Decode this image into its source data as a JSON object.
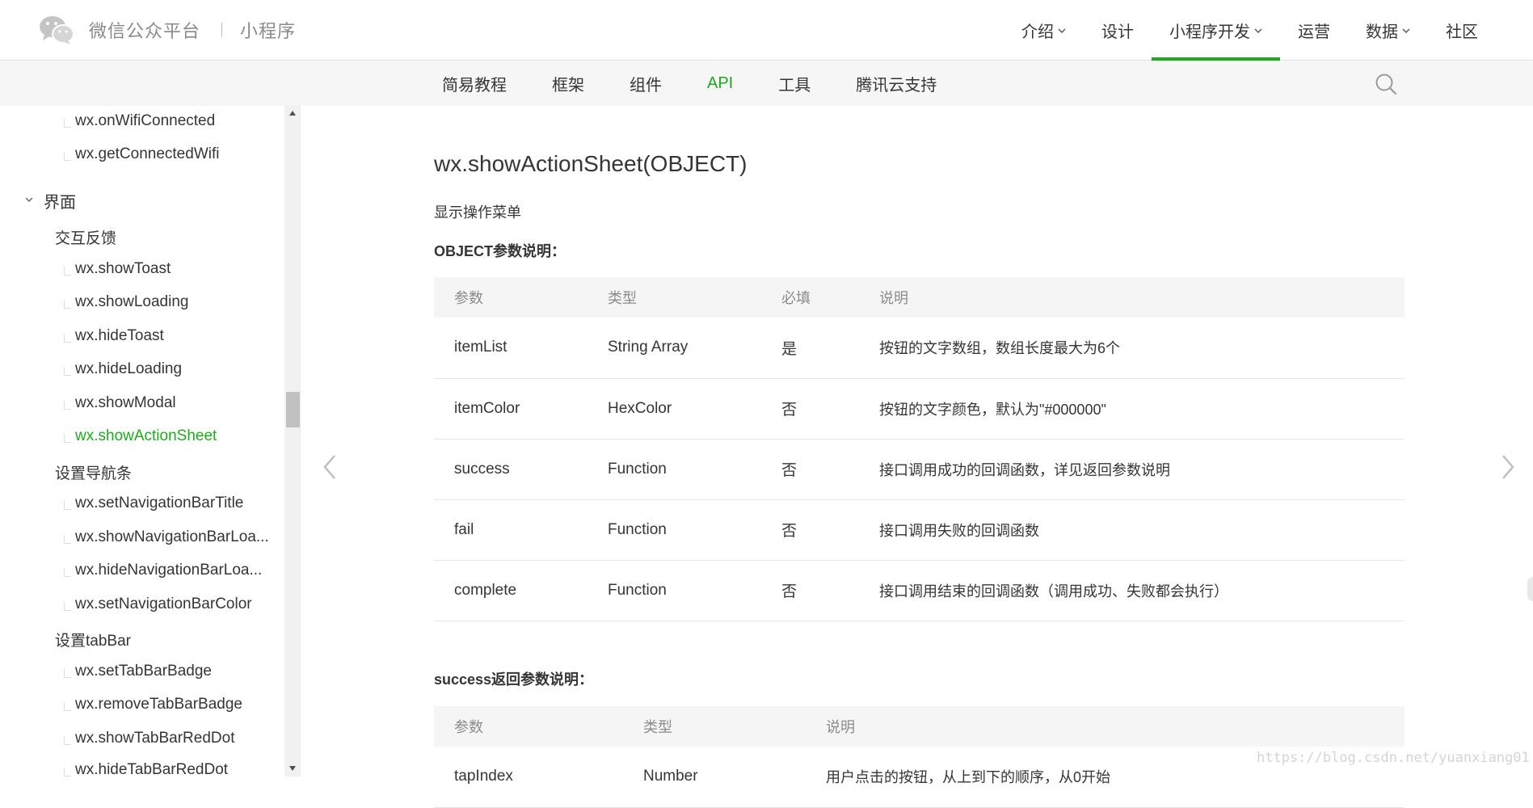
{
  "header": {
    "brand_name": "微信公众平台",
    "brand_sub": "小程序",
    "nav": [
      {
        "label": "介绍",
        "has_menu": true,
        "active": false
      },
      {
        "label": "设计",
        "has_menu": false,
        "active": false
      },
      {
        "label": "小程序开发",
        "has_menu": true,
        "active": true
      },
      {
        "label": "运营",
        "has_menu": false,
        "active": false
      },
      {
        "label": "数据",
        "has_menu": true,
        "active": false
      },
      {
        "label": "社区",
        "has_menu": false,
        "active": false
      }
    ],
    "accent_color": "#1aad19"
  },
  "subnav": {
    "items": [
      {
        "label": "简易教程",
        "active": false
      },
      {
        "label": "框架",
        "active": false
      },
      {
        "label": "组件",
        "active": false
      },
      {
        "label": "API",
        "active": true
      },
      {
        "label": "工具",
        "active": false
      },
      {
        "label": "腾讯云支持",
        "active": false
      }
    ],
    "search_icon": "search-icon"
  },
  "sidebar": {
    "items": [
      {
        "label": "wx.onWifiConnected",
        "level": 3
      },
      {
        "label": "wx.getConnectedWifi",
        "level": 3
      },
      {
        "label": "界面",
        "level": 1,
        "expanded": true
      },
      {
        "label": "交互反馈",
        "level": 2
      },
      {
        "label": "wx.showToast",
        "level": 3
      },
      {
        "label": "wx.showLoading",
        "level": 3
      },
      {
        "label": "wx.hideToast",
        "level": 3
      },
      {
        "label": "wx.hideLoading",
        "level": 3
      },
      {
        "label": "wx.showModal",
        "level": 3
      },
      {
        "label": "wx.showActionSheet",
        "level": 3,
        "active": true
      },
      {
        "label": "设置导航条",
        "level": 2
      },
      {
        "label": "wx.setNavigationBarTitle",
        "level": 3
      },
      {
        "label": "wx.showNavigationBarLoa...",
        "level": 3
      },
      {
        "label": "wx.hideNavigationBarLoa...",
        "level": 3
      },
      {
        "label": "wx.setNavigationBarColor",
        "level": 3
      },
      {
        "label": "设置tabBar",
        "level": 2
      },
      {
        "label": "wx.setTabBarBadge",
        "level": 3
      },
      {
        "label": "wx.removeTabBarBadge",
        "level": 3
      },
      {
        "label": "wx.showTabBarRedDot",
        "level": 3
      },
      {
        "label": "wx.hideTabBarRedDot",
        "level": 3
      }
    ]
  },
  "content": {
    "title": "wx.showActionSheet(OBJECT)",
    "description": "显示操作菜单",
    "object_section_title": "OBJECT参数说明：",
    "object_table": {
      "headers": [
        "参数",
        "类型",
        "必填",
        "说明"
      ],
      "rows": [
        [
          "itemList",
          "String Array",
          "是",
          "按钮的文字数组，数组长度最大为6个"
        ],
        [
          "itemColor",
          "HexColor",
          "否",
          "按钮的文字颜色，默认为\"#000000\""
        ],
        [
          "success",
          "Function",
          "否",
          "接口调用成功的回调函数，详见返回参数说明"
        ],
        [
          "fail",
          "Function",
          "否",
          "接口调用失败的回调函数"
        ],
        [
          "complete",
          "Function",
          "否",
          "接口调用结束的回调函数（调用成功、失败都会执行）"
        ]
      ]
    },
    "success_section_title": "success返回参数说明：",
    "success_table": {
      "headers": [
        "参数",
        "类型",
        "说明"
      ],
      "rows": [
        [
          "tapIndex",
          "Number",
          "用户点击的按钮，从上到下的顺序，从0开始"
        ]
      ]
    }
  },
  "watermark": "https://blog.csdn.net/yuanxiang01"
}
